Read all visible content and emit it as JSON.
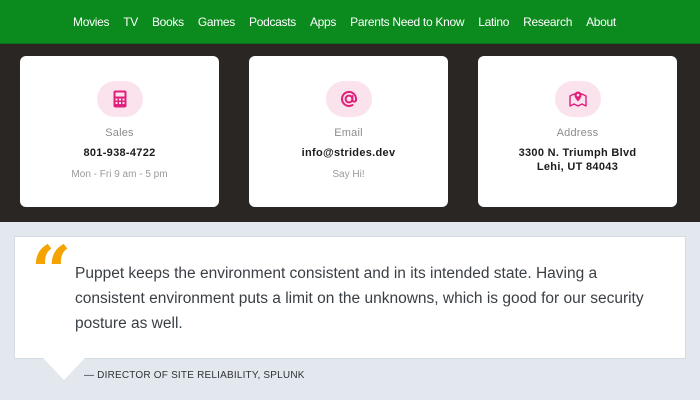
{
  "nav": {
    "items": [
      "Movies",
      "TV",
      "Books",
      "Games",
      "Podcasts",
      "Apps",
      "Parents Need to Know",
      "Latino",
      "Research",
      "About"
    ]
  },
  "contact": {
    "cards": [
      {
        "icon": "calculator-icon",
        "label": "Sales",
        "value": "801-938-4722",
        "sub": "Mon - Fri 9 am - 5 pm"
      },
      {
        "icon": "at-sign-icon",
        "label": "Email",
        "value": "info@strides.dev",
        "sub": "Say Hi!"
      },
      {
        "icon": "map-pin-icon",
        "label": "Address",
        "value_line1": "3300 N. Triumph Blvd",
        "value_line2": "Lehi, UT 84043"
      }
    ]
  },
  "testimonial": {
    "quote_mark": "“",
    "text": "Puppet keeps the environment consistent and in its intended state. Having a consistent environment puts a limit on the unknowns, which is good for our security posture as well.",
    "attribution": "— DIRECTOR OF SITE RELIABILITY, SPLUNK"
  },
  "colors": {
    "nav_bg": "#0b8a1e",
    "band_bg": "#2a2624",
    "icon_accent": "#e0207a",
    "icon_bg": "#fbe3ee",
    "quote_accent": "#f5a300"
  }
}
